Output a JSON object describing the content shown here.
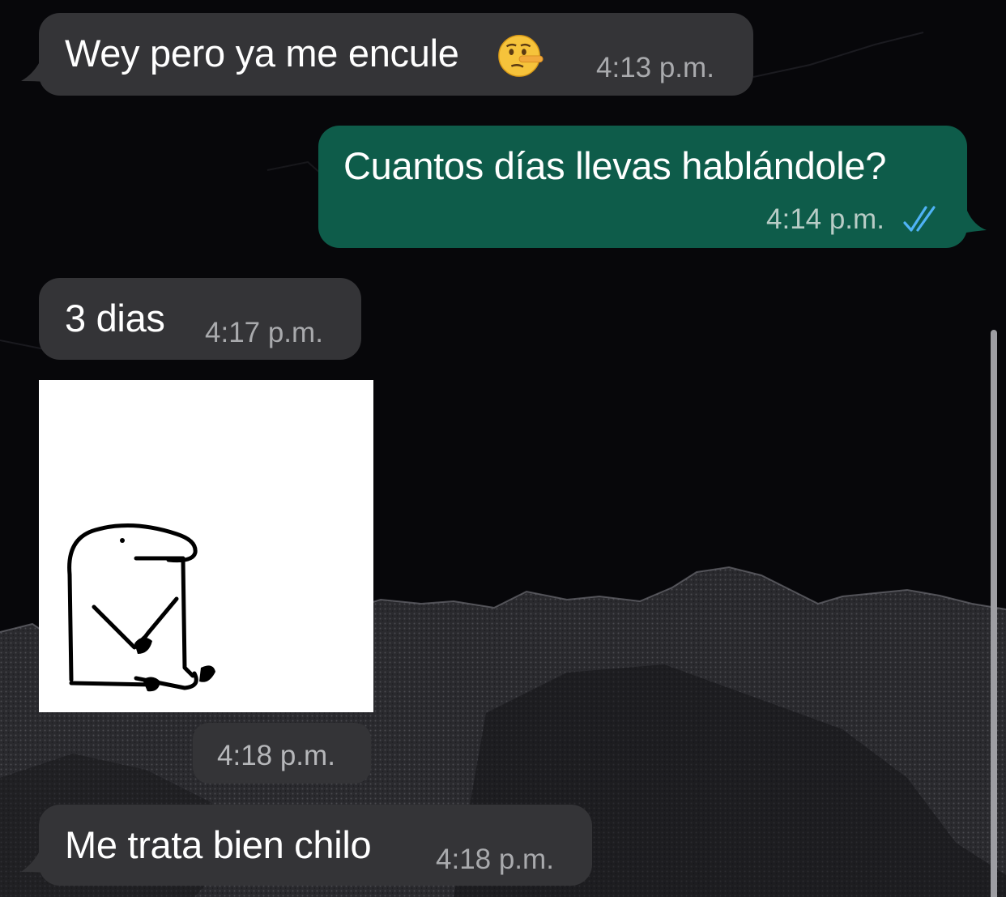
{
  "messages": [
    {
      "text": "Wey pero ya me encule",
      "emoji": "lying-face-emoji",
      "time": "4:13 p.m.",
      "direction": "incoming"
    },
    {
      "text": "Cuantos días llevas hablándole?",
      "time": "4:14 p.m.",
      "direction": "outgoing",
      "status": "read"
    },
    {
      "text": "3 dias",
      "time": "4:17 p.m.",
      "direction": "incoming"
    },
    {
      "sticker": "flork-sitting-sticker",
      "time": "4:18 p.m.",
      "direction": "incoming"
    },
    {
      "text": "Me trata bien chilo",
      "time": "4:18 p.m.",
      "direction": "incoming"
    }
  ],
  "colors": {
    "background": "#07070a",
    "incoming_bubble": "#343437",
    "outgoing_bubble": "#0e5c4a",
    "read_ticks": "#4fb3f6",
    "timestamp": "#a9aaad"
  }
}
